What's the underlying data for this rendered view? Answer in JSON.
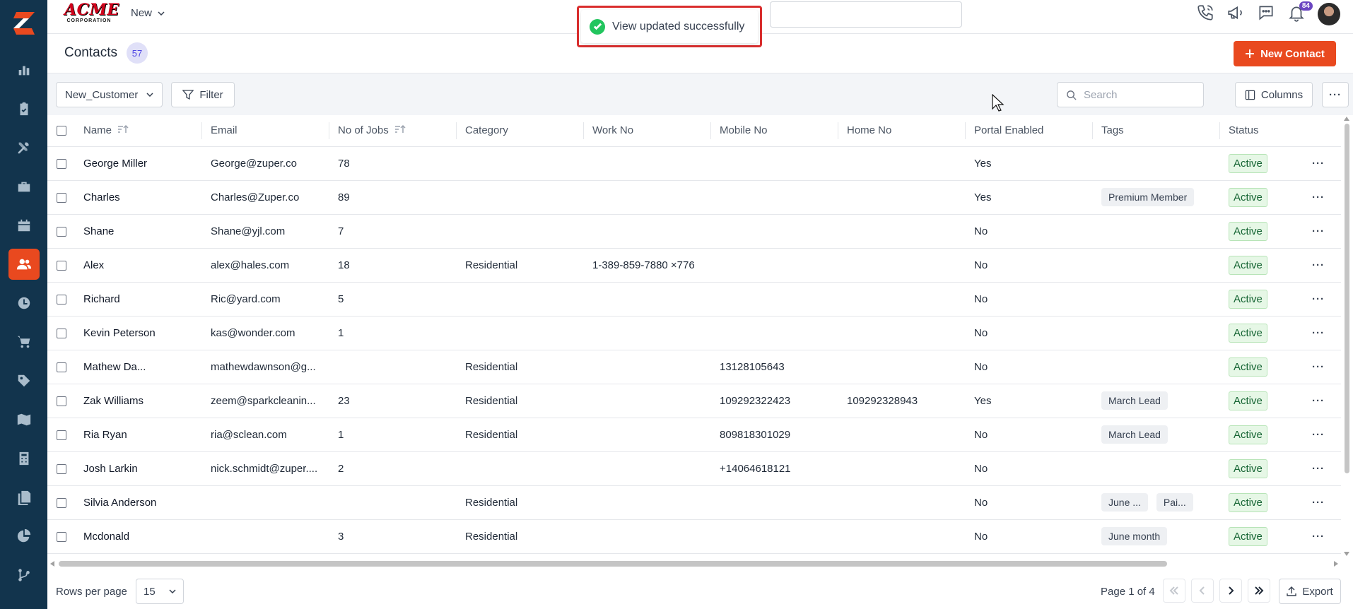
{
  "brand": {
    "name": "ACME",
    "subtitle": "CORPORATION"
  },
  "topbar": {
    "new_menu_label": "New",
    "notification_count": "84"
  },
  "toast": {
    "message": "View updated successfully"
  },
  "page": {
    "title": "Contacts",
    "count": "57",
    "new_contact_label": "New Contact"
  },
  "toolbar": {
    "view_name": "New_Customer",
    "filter_label": "Filter",
    "search_placeholder": "Search",
    "columns_label": "Columns"
  },
  "table": {
    "columns": [
      "Name",
      "Email",
      "No of Jobs",
      "Category",
      "Work No",
      "Mobile No",
      "Home No",
      "Portal Enabled",
      "Tags",
      "Status"
    ],
    "rows": [
      {
        "name": "George Miller",
        "email": "George@zuper.co",
        "jobs": "78",
        "category": "",
        "work": "",
        "mobile": "",
        "home": "",
        "portal": "Yes",
        "tags": [],
        "status": "Active"
      },
      {
        "name": "Charles",
        "email": "Charles@Zuper.co",
        "jobs": "89",
        "category": "",
        "work": "",
        "mobile": "",
        "home": "",
        "portal": "Yes",
        "tags": [
          "Premium Member"
        ],
        "status": "Active"
      },
      {
        "name": "Shane",
        "email": "Shane@yjl.com",
        "jobs": "7",
        "category": "",
        "work": "",
        "mobile": "",
        "home": "",
        "portal": "No",
        "tags": [],
        "status": "Active"
      },
      {
        "name": "Alex",
        "email": "alex@hales.com",
        "jobs": "18",
        "category": "Residential",
        "work": "1-389-859-7880 ×776",
        "mobile": "",
        "home": "",
        "portal": "No",
        "tags": [],
        "status": "Active"
      },
      {
        "name": "Richard",
        "email": "Ric@yard.com",
        "jobs": "5",
        "category": "",
        "work": "",
        "mobile": "",
        "home": "",
        "portal": "No",
        "tags": [],
        "status": "Active"
      },
      {
        "name": "Kevin Peterson",
        "email": "kas@wonder.com",
        "jobs": "1",
        "category": "",
        "work": "",
        "mobile": "",
        "home": "",
        "portal": "No",
        "tags": [],
        "status": "Active"
      },
      {
        "name": "Mathew Da...",
        "email": "mathewdawnson@g...",
        "jobs": "",
        "category": "Residential",
        "work": "",
        "mobile": "13128105643",
        "home": "",
        "portal": "No",
        "tags": [],
        "status": "Active"
      },
      {
        "name": "Zak Williams",
        "email": "zeem@sparkcleanin...",
        "jobs": "23",
        "category": "Residential",
        "work": "",
        "mobile": "109292322423",
        "home": "109292328943",
        "portal": "Yes",
        "tags": [
          "March Lead"
        ],
        "status": "Active"
      },
      {
        "name": "Ria Ryan",
        "email": "ria@sclean.com",
        "jobs": "1",
        "category": "Residential",
        "work": "",
        "mobile": "809818301029",
        "home": "",
        "portal": "No",
        "tags": [
          "March Lead"
        ],
        "status": "Active"
      },
      {
        "name": "Josh Larkin",
        "email": "nick.schmidt@zuper....",
        "jobs": "2",
        "category": "",
        "work": "",
        "mobile": "+14064618121",
        "home": "",
        "portal": "No",
        "tags": [],
        "status": "Active"
      },
      {
        "name": "Silvia Anderson",
        "email": "",
        "jobs": "",
        "category": "Residential",
        "work": "",
        "mobile": "",
        "home": "",
        "portal": "No",
        "tags": [
          "June ...",
          "Pai..."
        ],
        "status": "Active"
      },
      {
        "name": "Mcdonald",
        "email": "",
        "jobs": "3",
        "category": "Residential",
        "work": "",
        "mobile": "",
        "home": "",
        "portal": "No",
        "tags": [
          "June month"
        ],
        "status": "Active"
      }
    ]
  },
  "footer": {
    "rows_per_page_label": "Rows per page",
    "rows_per_page": "15",
    "page_info": "Page 1 of 4",
    "export_label": "Export"
  },
  "colors": {
    "sidebar_bg": "#12344d",
    "accent": "#e9491f",
    "status_active_bg": "#e6f7e6",
    "toast_border": "#d92d2d"
  }
}
